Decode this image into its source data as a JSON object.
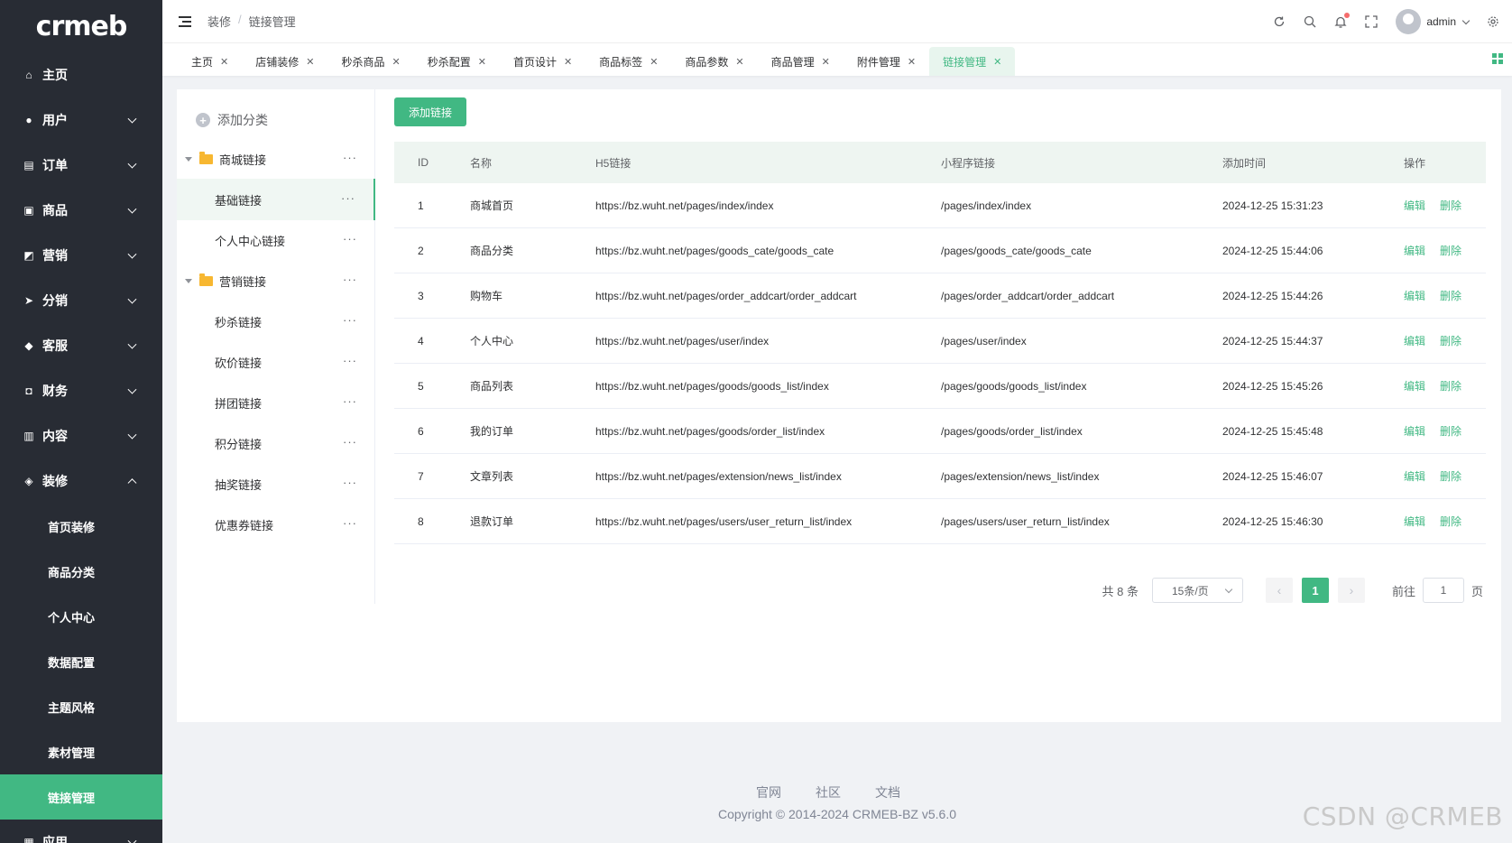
{
  "brand": {
    "logo": "crmeb"
  },
  "sidebar": {
    "items": [
      {
        "label": "主页",
        "icon": "home-icon",
        "glyph": "⌂",
        "expandable": false
      },
      {
        "label": "用户",
        "icon": "user-icon",
        "glyph": "●",
        "expandable": true
      },
      {
        "label": "订单",
        "icon": "order-icon",
        "glyph": "▤",
        "expandable": true
      },
      {
        "label": "商品",
        "icon": "product-icon",
        "glyph": "▣",
        "expandable": true
      },
      {
        "label": "营销",
        "icon": "marketing-icon",
        "glyph": "◩",
        "expandable": true
      },
      {
        "label": "分销",
        "icon": "distribution-icon",
        "glyph": "➤",
        "expandable": true
      },
      {
        "label": "客服",
        "icon": "bell-icon",
        "glyph": "◆",
        "expandable": true
      },
      {
        "label": "财务",
        "icon": "finance-icon",
        "glyph": "◘",
        "expandable": true
      },
      {
        "label": "内容",
        "icon": "content-icon",
        "glyph": "▥",
        "expandable": true
      },
      {
        "label": "装修",
        "icon": "decoration-icon",
        "glyph": "◈",
        "expandable": true,
        "expanded": true
      }
    ],
    "sub_items": [
      "首页装修",
      "商品分类",
      "个人中心",
      "数据配置",
      "主题风格",
      "素材管理",
      "链接管理"
    ],
    "active_sub": "链接管理",
    "bottom_item": {
      "label": "应用",
      "icon": "apps-icon",
      "glyph": "▦"
    }
  },
  "header": {
    "breadcrumb": [
      "装修",
      "链接管理"
    ],
    "breadcrumb_sep": "/",
    "user": "admin"
  },
  "tabs": [
    "主页",
    "店铺装修",
    "秒杀商品",
    "秒杀配置",
    "首页设计",
    "商品标签",
    "商品参数",
    "商品管理",
    "附件管理",
    "链接管理"
  ],
  "active_tab": "链接管理",
  "tree": {
    "add_label": "添加分类",
    "nodes": [
      {
        "label": "商城链接",
        "type": "parent"
      },
      {
        "label": "基础链接",
        "type": "child",
        "selected": true
      },
      {
        "label": "个人中心链接",
        "type": "child"
      },
      {
        "label": "营销链接",
        "type": "parent"
      },
      {
        "label": "秒杀链接",
        "type": "child"
      },
      {
        "label": "砍价链接",
        "type": "child"
      },
      {
        "label": "拼团链接",
        "type": "child"
      },
      {
        "label": "积分链接",
        "type": "child"
      },
      {
        "label": "抽奖链接",
        "type": "child"
      },
      {
        "label": "优惠券链接",
        "type": "child"
      }
    ],
    "more_glyph": "···"
  },
  "main": {
    "add_button": "添加链接",
    "table": {
      "headers": [
        "ID",
        "名称",
        "H5链接",
        "小程序链接",
        "添加时间",
        "操作"
      ],
      "rows": [
        {
          "id": "1",
          "name": "商城首页",
          "h5": "https://bz.wuht.net/pages/index/index",
          "mp": "/pages/index/index",
          "time": "2024-12-25 15:31:23"
        },
        {
          "id": "2",
          "name": "商品分类",
          "h5": "https://bz.wuht.net/pages/goods_cate/goods_cate",
          "mp": "/pages/goods_cate/goods_cate",
          "time": "2024-12-25 15:44:06"
        },
        {
          "id": "3",
          "name": "购物车",
          "h5": "https://bz.wuht.net/pages/order_addcart/order_addcart",
          "mp": "/pages/order_addcart/order_addcart",
          "time": "2024-12-25 15:44:26"
        },
        {
          "id": "4",
          "name": "个人中心",
          "h5": "https://bz.wuht.net/pages/user/index",
          "mp": "/pages/user/index",
          "time": "2024-12-25 15:44:37"
        },
        {
          "id": "5",
          "name": "商品列表",
          "h5": "https://bz.wuht.net/pages/goods/goods_list/index",
          "mp": "/pages/goods/goods_list/index",
          "time": "2024-12-25 15:45:26"
        },
        {
          "id": "6",
          "name": "我的订单",
          "h5": "https://bz.wuht.net/pages/goods/order_list/index",
          "mp": "/pages/goods/order_list/index",
          "time": "2024-12-25 15:45:48"
        },
        {
          "id": "7",
          "name": "文章列表",
          "h5": "https://bz.wuht.net/pages/extension/news_list/index",
          "mp": "/pages/extension/news_list/index",
          "time": "2024-12-25 15:46:07"
        },
        {
          "id": "8",
          "name": "退款订单",
          "h5": "https://bz.wuht.net/pages/users/user_return_list/index",
          "mp": "/pages/users/user_return_list/index",
          "time": "2024-12-25 15:46:30"
        }
      ],
      "edit_label": "编辑",
      "delete_label": "删除"
    },
    "pager": {
      "total": "共 8 条",
      "page_size": "15条/页",
      "current": "1",
      "prev": "‹",
      "next": "›",
      "goto_prefix": "前往",
      "goto_value": "1",
      "goto_suffix": "页"
    }
  },
  "footer": {
    "links": [
      "官网",
      "社区",
      "文档"
    ],
    "copyright": "Copyright © 2014-2024 CRMEB-BZ v5.6.0"
  },
  "watermark": "CSDN @CRMEB",
  "colors": {
    "accent": "#41b883",
    "sidebar_bg": "#282c34",
    "danger_dot": "#f56c6c"
  }
}
